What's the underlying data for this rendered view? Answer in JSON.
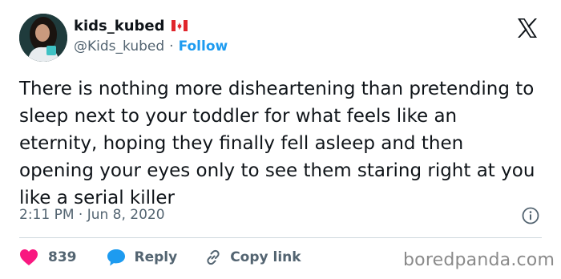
{
  "author": {
    "display_name": "kids_kubed",
    "handle": "@Kids_kubed",
    "separator": "·",
    "follow_label": "Follow"
  },
  "tweet": {
    "text": "There is nothing more disheartening than pretending to sleep next to your toddler for what feels like an eternity, hoping they finally fell asleep and then opening your eyes only to see them staring right at you like a serial killer",
    "timestamp": "2:11 PM · Jun 8, 2020"
  },
  "actions": {
    "likes": "839",
    "reply_label": "Reply",
    "copy_label": "Copy link"
  },
  "watermark": "boredpanda.com",
  "icons": {
    "like": "heart-icon",
    "reply": "reply-bubble-icon",
    "copy": "link-icon",
    "info": "info-icon",
    "brand": "x-logo-icon",
    "flag": "canada-flag-icon"
  },
  "colors": {
    "accent": "#1d9bf0",
    "like": "#f91880",
    "text": "#0f1419",
    "muted": "#536471"
  }
}
